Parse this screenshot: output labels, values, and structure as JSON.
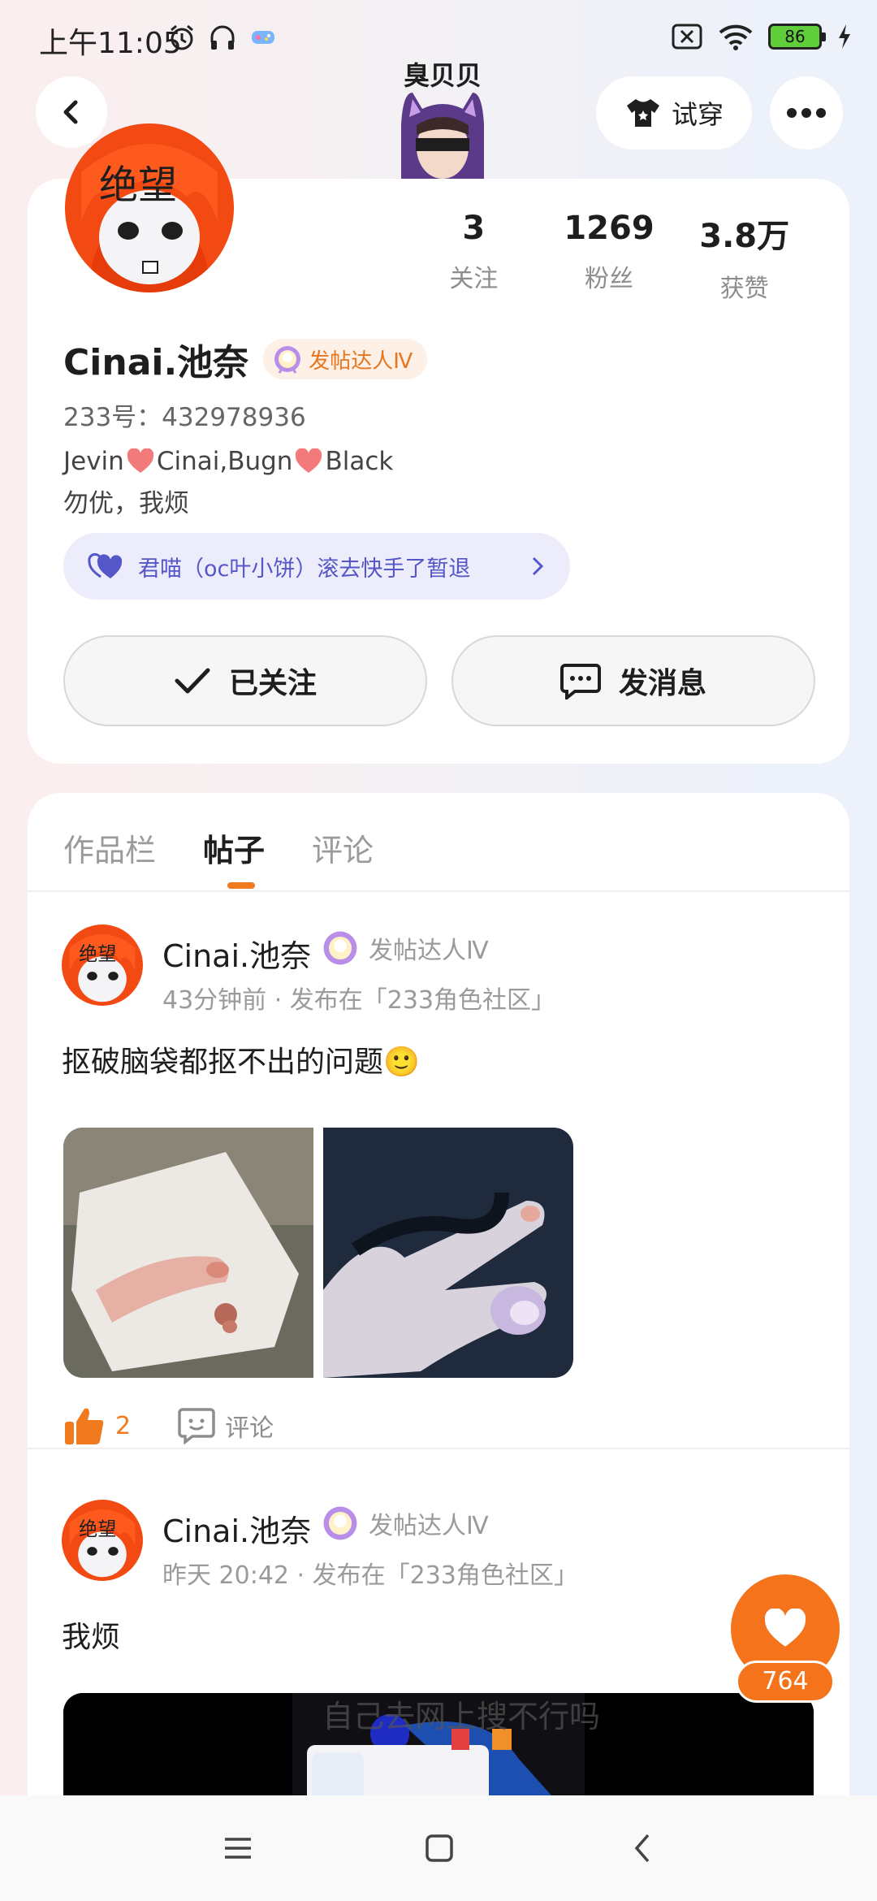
{
  "status_bar": {
    "time": "上午11:05",
    "battery": "86"
  },
  "header": {
    "deco_title": "臭贝贝",
    "try_on_label": "试穿"
  },
  "profile": {
    "avatar_text": "绝望",
    "stats": [
      {
        "value": "3",
        "label": "关注"
      },
      {
        "value": "1269",
        "label": "粉丝"
      },
      {
        "value": "3.8万",
        "label": "获赞"
      }
    ],
    "username": "Cinai.池奈",
    "badge_label": "发帖达人Ⅳ",
    "uid": "233号：432978936",
    "bio_line1_a": "Jevin",
    "bio_line1_b": "Cinai,Bugn",
    "bio_line1_c": "Black",
    "bio_line2": "勿优，我烦",
    "relation_text": "君喵（oc叶小饼）滚去快手了暂退",
    "follow_label": "已关注",
    "message_label": "发消息"
  },
  "tabs": [
    {
      "label": "作品栏"
    },
    {
      "label": "帖子"
    },
    {
      "label": "评论"
    }
  ],
  "posts": [
    {
      "author": "Cinai.池奈",
      "badge": "发帖达人Ⅳ",
      "time": "43分钟前",
      "meta_sep": " · ",
      "location": "发布在「233角色社区」",
      "text": "抠破脑袋都抠不出的问题🙂",
      "likes": "2",
      "comment_label": "评论"
    },
    {
      "author": "Cinai.池奈",
      "badge": "发帖达人Ⅳ",
      "time": "昨天 20:42",
      "meta_sep": " · ",
      "location": "发布在「233角色社区」",
      "text": "我烦",
      "image_caption": "自己去网上搜不行吗"
    }
  ],
  "fab": {
    "count": "764"
  },
  "colors": {
    "accent": "#f5731b",
    "relation_purple": "#5556c8"
  }
}
